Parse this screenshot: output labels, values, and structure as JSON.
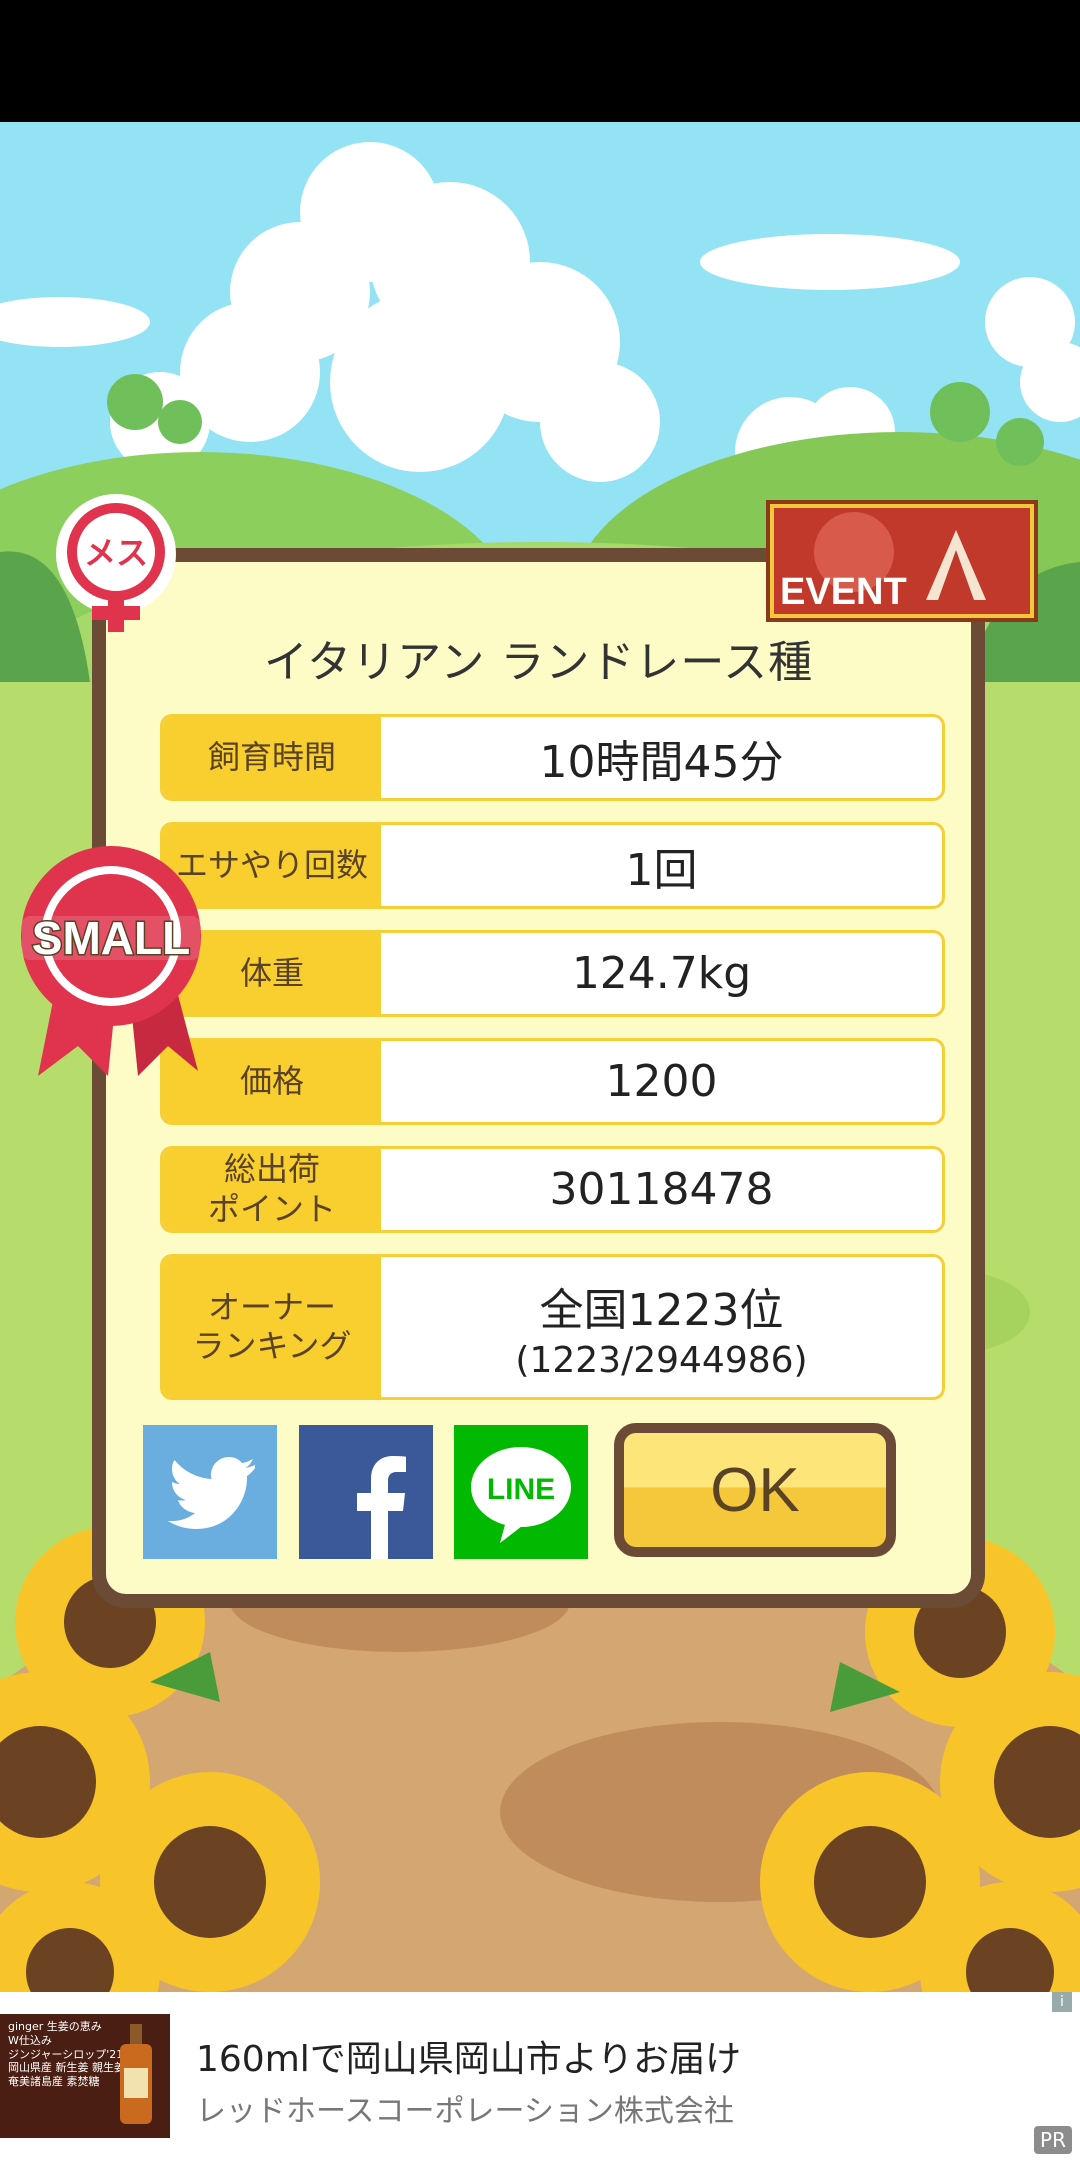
{
  "card": {
    "title": "イタリアン ランドレース種",
    "rows": [
      {
        "label": "飼育時間",
        "value": "10時間45分"
      },
      {
        "label": "エサやり回数",
        "value": "1回"
      },
      {
        "label": "体重",
        "value": "124.7kg"
      },
      {
        "label": "価格",
        "value": "1200"
      },
      {
        "label": "総出荷\nポイント",
        "value": "30118478"
      },
      {
        "label": "オーナー\nランキング",
        "value": "全国1223位",
        "value_sub": "(1223/2944986)"
      }
    ],
    "ok_label": "OK"
  },
  "badges": {
    "gender": "メス",
    "event": "EVENT",
    "size": "SMALL"
  },
  "share": {
    "line": "LINE",
    "facebook": "f"
  },
  "ad": {
    "title": "160mlで岡山県岡山市よりお届け",
    "advertiser": "レッドホースコーポレーション株式会社",
    "info": "i",
    "pr": "PR",
    "thumb_lines": [
      "ginger 生姜の恵み",
      "W仕込み",
      "ジンジャーシロップ'21",
      "岡山県産 新生姜 親生姜",
      "奄美諸島産 素焚糖"
    ]
  },
  "colors": {
    "sky": "#93e3f5",
    "panel": "#fefcc6",
    "panel_border": "#6b4b36",
    "label_bg": "#f9cf2f",
    "twitter": "#6aaee0",
    "facebook": "#3b5998",
    "line": "#00b900"
  }
}
